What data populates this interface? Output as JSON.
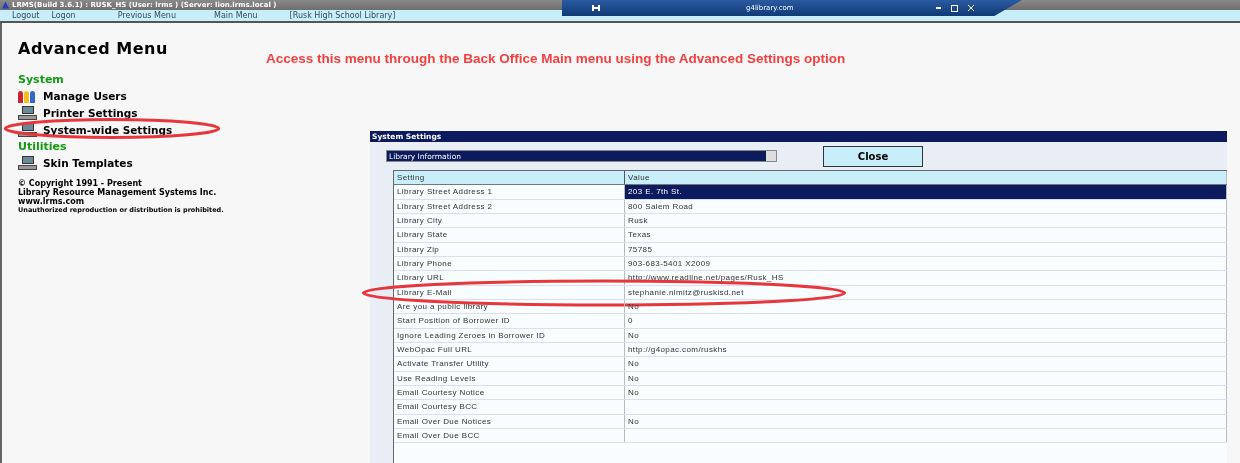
{
  "window": {
    "title": "LRMS(Build 3.6.1) : RUSK_HS (User: lrms ) (Server: lion.lrms.local )",
    "browser_tab": "g4library.com"
  },
  "menu_bar": [
    {
      "label": "Logout"
    },
    {
      "label": "Logon"
    },
    {
      "label": "Previous Menu"
    },
    {
      "label": "Main Menu"
    },
    {
      "label": "[Rusk High School Library]"
    }
  ],
  "heading": "Advanced Menu",
  "instruction": "Access this menu through the Back Office Main menu using the Advanced Settings option",
  "sections": [
    {
      "title": "System",
      "items": [
        {
          "label": "Manage Users",
          "kind": "users",
          "highlighted": false
        },
        {
          "label": "Printer Settings",
          "kind": "computer",
          "highlighted": false
        },
        {
          "label": "System-wide Settings",
          "kind": "computer",
          "highlighted": true
        }
      ]
    },
    {
      "title": "Utilities",
      "items": [
        {
          "label": "Skin Templates",
          "kind": "computer",
          "highlighted": false
        }
      ]
    }
  ],
  "copyright": [
    "© Copyright 1991 - Present",
    "Library Resource Management Systems Inc.",
    "www.lrms.com",
    "Unauthorized reproduction or distribution is prohibited."
  ],
  "dialog": {
    "title": "System Settings",
    "category": "Library Information",
    "close_button": "Close",
    "columns": [
      "Setting",
      "Value"
    ],
    "rows": [
      {
        "setting": "Library Street Address 1",
        "value": "203 E. 7th St.",
        "selected": true,
        "highlighted": false
      },
      {
        "setting": "Library Street Address 2",
        "value": "800 Salem Road",
        "selected": false,
        "highlighted": false
      },
      {
        "setting": "Library City",
        "value": "Rusk",
        "selected": false,
        "highlighted": false
      },
      {
        "setting": "Library State",
        "value": "Texas",
        "selected": false,
        "highlighted": false
      },
      {
        "setting": "Library Zip",
        "value": "75785",
        "selected": false,
        "highlighted": false
      },
      {
        "setting": "Library Phone",
        "value": "903-683-5401 X2009",
        "selected": false,
        "highlighted": false
      },
      {
        "setting": "Library URL",
        "value": "http://www.readline.net/pages/Rusk_HS",
        "selected": false,
        "highlighted": false
      },
      {
        "setting": "Library E-Mail",
        "value": "stephanie.nimitz@ruskisd.net",
        "selected": false,
        "highlighted": true
      },
      {
        "setting": "Are you a public library",
        "value": "No",
        "selected": false,
        "highlighted": false
      },
      {
        "setting": "Start Position of Borrower ID",
        "value": "0",
        "selected": false,
        "highlighted": false
      },
      {
        "setting": "Ignore Leading Zeroes in Borrower ID",
        "value": "No",
        "selected": false,
        "highlighted": false
      },
      {
        "setting": "WebOpac Full URL",
        "value": "http://g4opac.com/ruskhs",
        "selected": false,
        "highlighted": false
      },
      {
        "setting": "Activate Transfer Utility",
        "value": "No",
        "selected": false,
        "highlighted": false
      },
      {
        "setting": "Use Reading Levels",
        "value": "No",
        "selected": false,
        "highlighted": false
      },
      {
        "setting": "Email Courtesy Notice",
        "value": "No",
        "selected": false,
        "highlighted": false
      },
      {
        "setting": "Email Courtesy BCC",
        "selected": false,
        "highlighted": false
      },
      {
        "setting": "Email Over Due Notices",
        "value": "No",
        "selected": false,
        "highlighted": false
      },
      {
        "setting": "Email Over Due BCC",
        "selected": false,
        "highlighted": false
      }
    ]
  }
}
